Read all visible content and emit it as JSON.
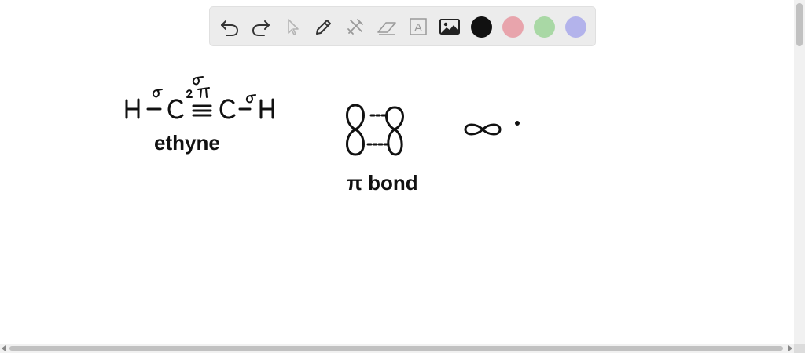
{
  "toolbar": {
    "tools": [
      {
        "name": "undo-icon"
      },
      {
        "name": "redo-icon"
      },
      {
        "name": "select-pointer-icon"
      },
      {
        "name": "pen-icon"
      },
      {
        "name": "tools-icon"
      },
      {
        "name": "eraser-icon"
      },
      {
        "name": "text-icon",
        "glyph": "A"
      },
      {
        "name": "image-icon"
      }
    ],
    "colors": [
      "#111111",
      "#e8a4ac",
      "#a9d8a5",
      "#b3b3eb"
    ]
  },
  "canvas": {
    "handwriting": {
      "ethyne_label": "ethyne",
      "pi_bond_label": "π bond"
    }
  }
}
